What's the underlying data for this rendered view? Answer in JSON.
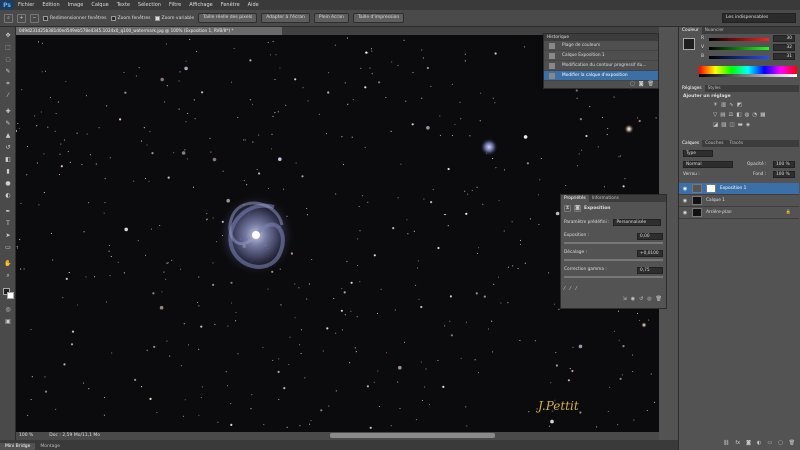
{
  "app": {
    "logo": "Ps"
  },
  "menu": [
    "Fichier",
    "Edition",
    "Image",
    "Calque",
    "Texte",
    "Sélection",
    "Filtre",
    "Affichage",
    "Fenêtre",
    "Aide"
  ],
  "options": {
    "resize_windows": "Redimensionner fenêtres",
    "zoom_all": "Zoom fenêtres",
    "scrubby_zoom": "Zoom variable",
    "actual_pixels": "Taille réelle des pixels",
    "fit_screen": "Adapter à l'écran",
    "fill_screen": "Plein écran",
    "print_size": "Taille d'impression"
  },
  "workspace": "Les indispensables",
  "document": {
    "tab_title": "049d231d25b381d0ed549eb578e4345.1024x0_q100_watermark.jpg @ 100% (Exposition 1, RVB/8*) *"
  },
  "watermark": "J.Pettit",
  "status": {
    "zoom": "100 %",
    "doc": "Doc : 2,59 Mo/11,1 Mo"
  },
  "bottom_tabs": [
    "Mini Bridge",
    "Montage"
  ],
  "history": {
    "title": "Historique",
    "items": [
      "Plage de couleurs",
      "Calque Exposition 1",
      "Modification du contour progressif du...",
      "Modifier la calque d'exposition"
    ]
  },
  "properties": {
    "tabs": [
      "Propriétés",
      "Informations"
    ],
    "adj_name": "Exposition",
    "preset_label": "Paramètre prédéfini :",
    "preset_value": "Personnalisée",
    "exposure_label": "Exposition :",
    "exposure_value": "0,00",
    "offset_label": "Décalage :",
    "offset_value": "+0,0100",
    "gamma_label": "Correction gamma :",
    "gamma_value": "0,75"
  },
  "color_panel": {
    "tabs": [
      "Couleur",
      "Nuancier"
    ],
    "r": "30",
    "g": "32",
    "b": "31",
    "r_label": "R",
    "g_label": "V",
    "b_label": "B"
  },
  "adjustments": {
    "tabs": [
      "Réglages",
      "Styles"
    ],
    "title": "Ajouter un réglage"
  },
  "layers": {
    "tabs": [
      "Calques",
      "Couches",
      "Tracés"
    ],
    "filter": "Type",
    "blend": "Normal",
    "opacity_label": "Opacité :",
    "opacity": "100 %",
    "lock_label": "Verrou :",
    "fill_label": "Fond :",
    "fill": "100 %",
    "items": [
      "Exposition 1",
      "Calque 1",
      "Arrière-plan"
    ]
  },
  "colors": {
    "accent": "#3a6fa8",
    "watermark": "#d4b040"
  }
}
